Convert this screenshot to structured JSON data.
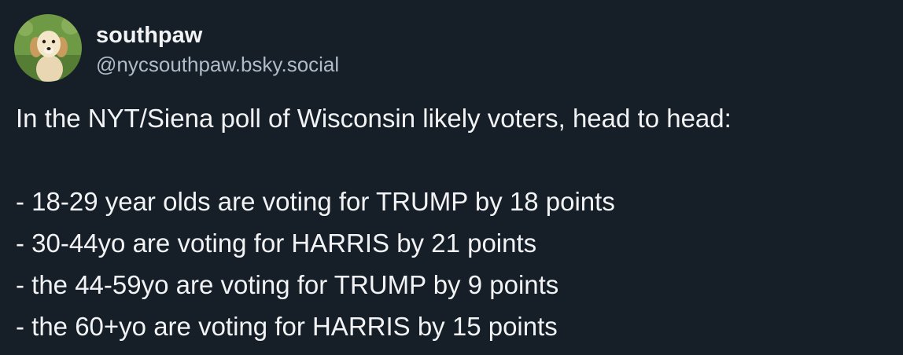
{
  "post": {
    "author": {
      "display_name": "southpaw",
      "handle": "@nycsouthpaw.bsky.social",
      "avatar_icon": "golden-retriever-puppy-avatar"
    },
    "text": {
      "intro": "In the NYT/Siena poll of Wisconsin likely voters, head to head:",
      "lines": [
        "- 18-29 year olds are voting for TRUMP by 18 points",
        "- 30-44yo are voting for HARRIS by 21 points",
        "- the 44-59yo are voting for TRUMP by 9 points",
        "- the 60+yo are voting for HARRIS by 15 points"
      ]
    }
  },
  "colors": {
    "background": "#161e27",
    "text": "#f1f3f5",
    "handle": "#aebbc9"
  }
}
